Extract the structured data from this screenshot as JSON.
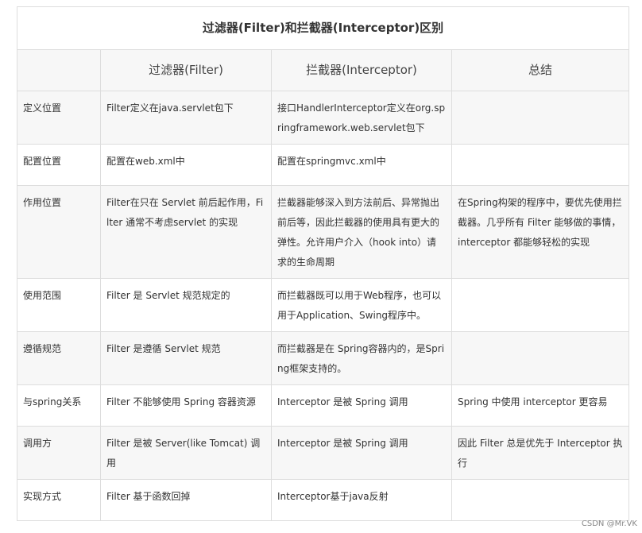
{
  "table": {
    "title": "过滤器(Filter)和拦截器(Interceptor)区别",
    "headers": [
      "",
      "过滤器(Filter)",
      "拦截器(Interceptor)",
      "总结"
    ],
    "rows": [
      {
        "label": "定义位置",
        "filter": "Filter定义在java.servlet包下",
        "interceptor": "接口HandlerInterceptor定义在org.springframework.web.servlet包下",
        "summary": ""
      },
      {
        "label": "配置位置",
        "filter": "配置在web.xml中",
        "interceptor": "配置在springmvc.xml中",
        "summary": ""
      },
      {
        "label": "作用位置",
        "filter": "Filter在只在 Servlet 前后起作用，Filter 通常不考虑servlet 的实现",
        "interceptor": "拦截器能够深入到方法前后、异常抛出前后等，因此拦截器的使用具有更大的弹性。允许用户介入（hook into）请求的生命周期",
        "summary": "在Spring构架的程序中，要优先使用拦截器。几乎所有 Filter 能够做的事情，interceptor 都能够轻松的实现"
      },
      {
        "label": "使用范围",
        "filter": "Filter 是 Servlet 规范规定的",
        "interceptor": "而拦截器既可以用于Web程序，也可以用于Application、Swing程序中。",
        "summary": ""
      },
      {
        "label": "遵循规范",
        "filter": "Filter 是遵循 Servlet 规范",
        "interceptor": "而拦截器是在 Spring容器内的，是Spring框架支持的。",
        "summary": ""
      },
      {
        "label": "与spring关系",
        "filter": "Filter 不能够使用 Spring 容器资源",
        "interceptor": "Interceptor 是被 Spring 调用",
        "summary": "Spring 中使用 interceptor 更容易"
      },
      {
        "label": "调用方",
        "filter": "Filter 是被 Server(like Tomcat) 调用",
        "interceptor": "Interceptor 是被 Spring 调用",
        "summary": "因此 Filter 总是优先于 Interceptor 执行"
      },
      {
        "label": "实现方式",
        "filter": "Filter 基于函数回掉",
        "interceptor": "Interceptor基于java反射",
        "summary": ""
      }
    ]
  },
  "watermark": "CSDN @Mr.VK"
}
